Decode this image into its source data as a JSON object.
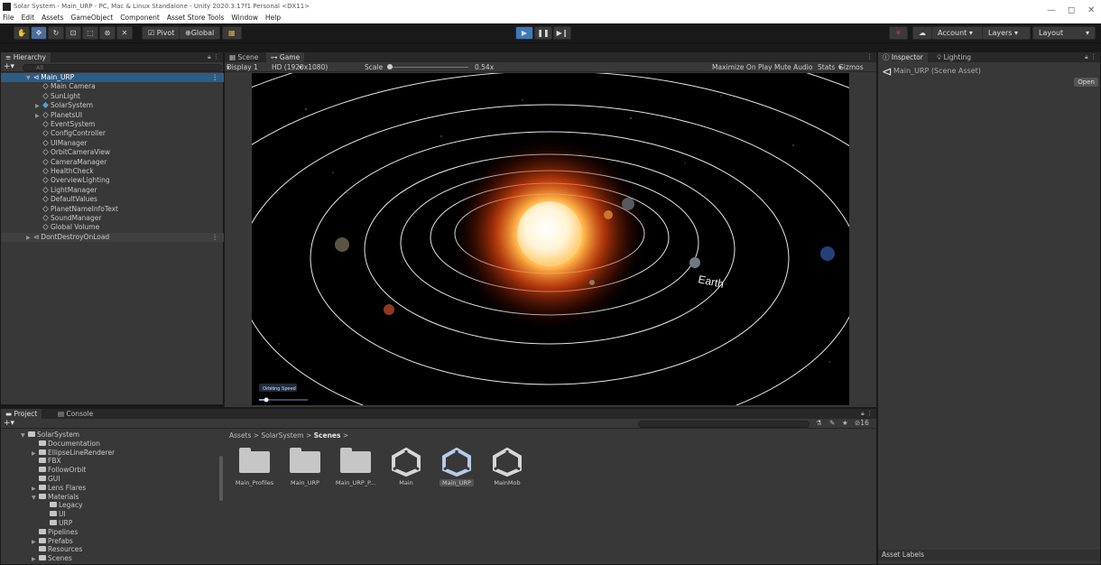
{
  "window": {
    "title": "Solar System - Main_URP - PC, Mac & Linux Standalone - Unity 2020.3.17f1 Personal <DX11>",
    "menu": [
      "File",
      "Edit",
      "Assets",
      "GameObject",
      "Component",
      "Asset Store Tools",
      "Window",
      "Help"
    ],
    "min": "—",
    "max": "◻",
    "close": "✕"
  },
  "toolbar": {
    "pivot": "Pivot",
    "global": "Global",
    "account": "Account",
    "layers": "Layers",
    "layout": "Layout"
  },
  "hierarchy": {
    "tab": "Hierarchy",
    "search_placeholder": "All",
    "scene": "Main_URP",
    "items": [
      {
        "label": "Main Camera",
        "expand": ""
      },
      {
        "label": "SunLight",
        "expand": ""
      },
      {
        "label": "SolarSystem",
        "expand": "▶"
      },
      {
        "label": "PlanetsUI",
        "expand": "▶"
      },
      {
        "label": "EventSystem",
        "expand": ""
      },
      {
        "label": "ConfigController",
        "expand": ""
      },
      {
        "label": "UIManager",
        "expand": ""
      },
      {
        "label": "OrbitCameraView",
        "expand": ""
      },
      {
        "label": "CameraManager",
        "expand": ""
      },
      {
        "label": "HealthCheck",
        "expand": ""
      },
      {
        "label": "OverviewLighting",
        "expand": ""
      },
      {
        "label": "LightManager",
        "expand": ""
      },
      {
        "label": "DefaultValues",
        "expand": ""
      },
      {
        "label": "PlanetNameInfoText",
        "expand": ""
      },
      {
        "label": "SoundManager",
        "expand": ""
      },
      {
        "label": "Global Volume",
        "expand": ""
      }
    ],
    "dont_destroy": "DontDestroyOnLoad"
  },
  "game": {
    "tab_scene": "Scene",
    "tab_game": "Game",
    "display": "Display 1",
    "resolution": "HD (1920x1080)",
    "scale_label": "Scale",
    "scale_value": "0.54x",
    "maximize": "Maximize On Play",
    "mute": "Mute Audio",
    "stats": "Stats",
    "gizmos": "Gizmos",
    "planet_label": "Earth",
    "orbit_speed_label": "Orbiting Speed",
    "orbit_speed_value": 0.15
  },
  "inspector": {
    "tab": "Inspector",
    "lighting_tab": "Lighting",
    "asset_name": "Main_URP (Scene Asset)",
    "open": "Open",
    "asset_labels": "Asset Labels"
  },
  "project": {
    "tab": "Project",
    "console_tab": "Console",
    "badge": "16",
    "breadcrumb": [
      "Assets",
      "SolarSystem",
      "Scenes"
    ],
    "tree": [
      {
        "label": "SolarSystem",
        "indent": 0,
        "expand": "▼"
      },
      {
        "label": "Documentation",
        "indent": 1,
        "expand": ""
      },
      {
        "label": "EllipseLineRenderer",
        "indent": 1,
        "expand": "▶"
      },
      {
        "label": "FBX",
        "indent": 1,
        "expand": ""
      },
      {
        "label": "FollowOrbit",
        "indent": 1,
        "expand": ""
      },
      {
        "label": "GUI",
        "indent": 1,
        "expand": ""
      },
      {
        "label": "Lens Flares",
        "indent": 1,
        "expand": "▶"
      },
      {
        "label": "Materials",
        "indent": 1,
        "expand": "▼"
      },
      {
        "label": "Legacy",
        "indent": 2,
        "expand": ""
      },
      {
        "label": "UI",
        "indent": 2,
        "expand": ""
      },
      {
        "label": "URP",
        "indent": 2,
        "expand": ""
      },
      {
        "label": "Pipelines",
        "indent": 1,
        "expand": ""
      },
      {
        "label": "Prefabs",
        "indent": 1,
        "expand": "▶"
      },
      {
        "label": "Resources",
        "indent": 1,
        "expand": ""
      },
      {
        "label": "Scenes",
        "indent": 1,
        "expand": "▶"
      }
    ],
    "assets": [
      {
        "label": "Main_Profiles",
        "kind": "folder"
      },
      {
        "label": "Main_URP",
        "kind": "folder"
      },
      {
        "label": "Main_URP_P...",
        "kind": "folder"
      },
      {
        "label": "Main",
        "kind": "scene"
      },
      {
        "label": "Main_URP",
        "kind": "scene"
      },
      {
        "label": "MainMob",
        "kind": "scene"
      }
    ]
  },
  "colors": {
    "accent_blue": "#3a79bb",
    "selected_row": "#2c5d87",
    "sun_core": "#fff6d8",
    "sun_glow": "#ff6a1a"
  }
}
